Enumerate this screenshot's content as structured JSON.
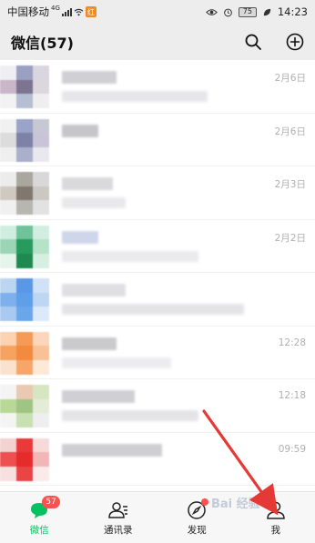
{
  "status_bar": {
    "carrier": "中国移动",
    "signal_tag": "4G",
    "app_badge": "红",
    "battery": "75",
    "time": "14:23"
  },
  "header": {
    "title": "微信(57)",
    "search_icon": "search-icon",
    "add_icon": "plus-circle-icon"
  },
  "chats": [
    {
      "time": "2月6日",
      "avatar_colors": [
        "#eeeef3",
        "#9aa0c2",
        "#d9d6e0",
        "#c9b6c8",
        "#7c7490",
        "#dcd6dd",
        "#f2f2f2",
        "#b6bed2",
        "#eeeeee"
      ],
      "name_color": "#d0d0d4",
      "name_w": 60,
      "msg_color": "#e6e6ea",
      "msg_w": 160
    },
    {
      "time": "2月6日",
      "avatar_colors": [
        "#f1f1f1",
        "#9aa3c8",
        "#c8c8d4",
        "#dcdcdc",
        "#7d82a6",
        "#c9c4d8",
        "#efefef",
        "#aab0cc",
        "#e8e8ee"
      ],
      "name_color": "#c6c6c8",
      "name_w": 40,
      "msg_color": "#e4e4e6",
      "msg_w": 0
    },
    {
      "time": "2月3日",
      "avatar_colors": [
        "#ececec",
        "#a9a79e",
        "#d8d8d8",
        "#cfc9c0",
        "#80786e",
        "#cbc8c4",
        "#f0f0f0",
        "#b8b6b0",
        "#e2e2e2"
      ],
      "name_color": "#d9d9db",
      "name_w": 56,
      "msg_color": "#e8e8ea",
      "msg_w": 70
    },
    {
      "time": "2月2日",
      "avatar_colors": [
        "#cfeee0",
        "#6fc29a",
        "#d2eee0",
        "#9ad6b6",
        "#279a5d",
        "#b6e2c8",
        "#e6f5ec",
        "#1e8a4f",
        "#d6efe0"
      ],
      "name_color": "#cfd6ea",
      "name_w": 40,
      "msg_color": "#eaeaec",
      "msg_w": 150
    },
    {
      "time": "",
      "avatar_colors": [
        "#bcd6f2",
        "#5a98e6",
        "#cfe2f6",
        "#7db0ec",
        "#5ea0e8",
        "#bcd6f4",
        "#a9c9f0",
        "#6aa6ea",
        "#dbe9f8"
      ],
      "name_color": "#e0e0e2",
      "name_w": 70,
      "msg_color": "#e4e4e6",
      "msg_w": 200
    },
    {
      "time": "12:28",
      "avatar_colors": [
        "#fbd2b2",
        "#f59b55",
        "#fbd6ba",
        "#f7a25e",
        "#f28b3f",
        "#f8c296",
        "#fbe2cf",
        "#f6a66a",
        "#fde9d8"
      ],
      "name_color": "#cacacc",
      "name_w": 60,
      "msg_color": "#ececee",
      "msg_w": 120
    },
    {
      "time": "12:18",
      "avatar_colors": [
        "#f4f4f4",
        "#e9c9b0",
        "#d6e6c2",
        "#b9d896",
        "#9fc483",
        "#e4ecd8",
        "#f4f4f4",
        "#c9e0b2",
        "#eeeeee"
      ],
      "name_color": "#d0d0d4",
      "name_w": 80,
      "msg_color": "#e4e4e6",
      "msg_w": 150
    },
    {
      "time": "09:59",
      "avatar_colors": [
        "#f3d2d2",
        "#e83a3a",
        "#f6dada",
        "#ee5050",
        "#e52b2b",
        "#f2b6b6",
        "#f7e0e0",
        "#e94545",
        "#faeaea"
      ],
      "name_color": "#cfcfd2",
      "name_w": 110,
      "msg_color": "#ececee",
      "msg_w": 0
    }
  ],
  "tabs": [
    {
      "label": "微信",
      "icon": "chat-bubble-icon",
      "badge": "57"
    },
    {
      "label": "通讯录",
      "icon": "contacts-icon",
      "badge": ""
    },
    {
      "label": "发现",
      "icon": "compass-icon",
      "badge": ""
    },
    {
      "label": "我",
      "icon": "person-icon",
      "badge": ""
    }
  ],
  "colors": {
    "accent_green": "#07c160",
    "badge_red": "#fa5151",
    "arrow_red": "#e53935"
  },
  "watermark": "Bai 经验"
}
